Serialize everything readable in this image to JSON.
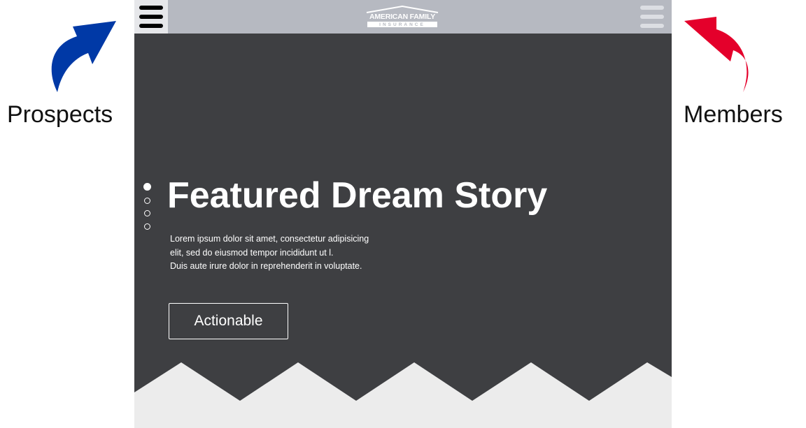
{
  "annotations": {
    "left_label": "Prospects",
    "right_label": "Members",
    "left_arrow_color": "#0039a6",
    "right_arrow_color": "#e4002b"
  },
  "header": {
    "logo_line1": "AMERICAN FAMILY",
    "logo_line2": "INSURANCE",
    "left_menu_icon": "hamburger-menu-icon",
    "right_menu_icon": "hamburger-menu-icon"
  },
  "hero": {
    "title": "Featured Dream Story",
    "body_lines": [
      "Lorem ipsum dolor sit amet, consectetur adipisicing",
      "elit, sed do eiusmod tempor incididunt ut l.",
      "Duis aute irure dolor in reprehenderit in voluptate."
    ],
    "cta_label": "Actionable",
    "slide_count": 4,
    "active_slide": 1
  },
  "colors": {
    "hero_background": "#3e3f42",
    "header_background": "#b6b9c1",
    "footer_background": "#ececec"
  }
}
